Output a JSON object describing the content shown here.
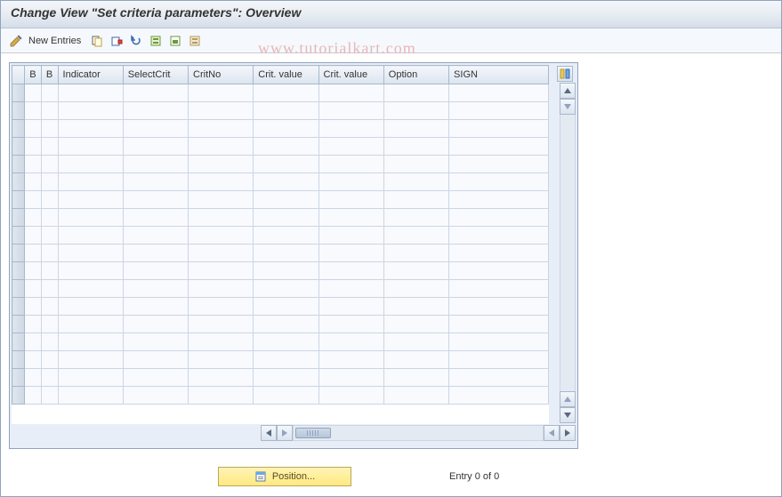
{
  "header": {
    "title": "Change View \"Set criteria parameters\": Overview"
  },
  "toolbar": {
    "new_entries_label": "New Entries",
    "icons": {
      "edit": "edit-icon",
      "copy": "copy-icon",
      "delete": "delete-icon",
      "undo": "undo-icon",
      "select_all": "select-all-icon",
      "select_block": "select-block-icon",
      "deselect_all": "deselect-all-icon"
    }
  },
  "watermark": "www.tutorialkart.com",
  "table": {
    "columns": [
      "B",
      "B",
      "Indicator",
      "SelectCrit",
      "CritNo",
      "Crit. value",
      "Crit. value",
      "Option",
      "SIGN"
    ],
    "rows": [
      [],
      [],
      [],
      [],
      [],
      [],
      [],
      [],
      [],
      [],
      [],
      [],
      [],
      [],
      [],
      [],
      [],
      []
    ]
  },
  "footer": {
    "position_label": "Position...",
    "entry_status": "Entry 0 of 0"
  }
}
